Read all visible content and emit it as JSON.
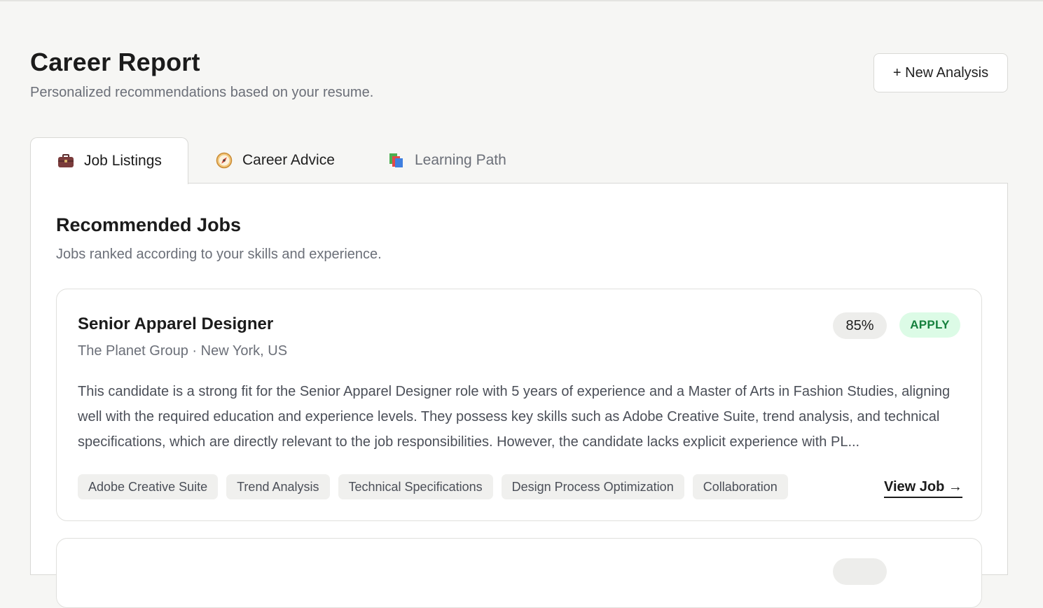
{
  "header": {
    "title": "Career Report",
    "subtitle": "Personalized recommendations based on your resume.",
    "new_analysis_label": "+ New Analysis"
  },
  "tabs": [
    {
      "label": "Job Listings",
      "icon": "briefcase-icon",
      "active": true
    },
    {
      "label": "Career Advice",
      "icon": "compass-icon",
      "active": false
    },
    {
      "label": "Learning Path",
      "icon": "books-icon",
      "active": false
    }
  ],
  "section": {
    "title": "Recommended Jobs",
    "subtitle": "Jobs ranked according to your skills and experience."
  },
  "jobs": [
    {
      "title": "Senior Apparel Designer",
      "meta": "The Planet Group · New York, US",
      "match": "85%",
      "status": "APPLY",
      "description": "This candidate is a strong fit for the Senior Apparel Designer role with 5 years of experience and a Master of Arts in Fashion Studies, aligning well with the required education and experience levels. They possess key skills such as Adobe Creative Suite, trend analysis, and technical specifications, which are directly relevant to the job responsibilities. However, the candidate lacks explicit experience with PL...",
      "skills": [
        "Adobe Creative Suite",
        "Trend Analysis",
        "Technical Specifications",
        "Design Process Optimization",
        "Collaboration"
      ],
      "view_label": "View Job →"
    }
  ],
  "colors": {
    "background": "#f6f6f4",
    "apply_bg": "#dcfbe6",
    "apply_text": "#15803d",
    "muted_text": "#6b6f78"
  }
}
